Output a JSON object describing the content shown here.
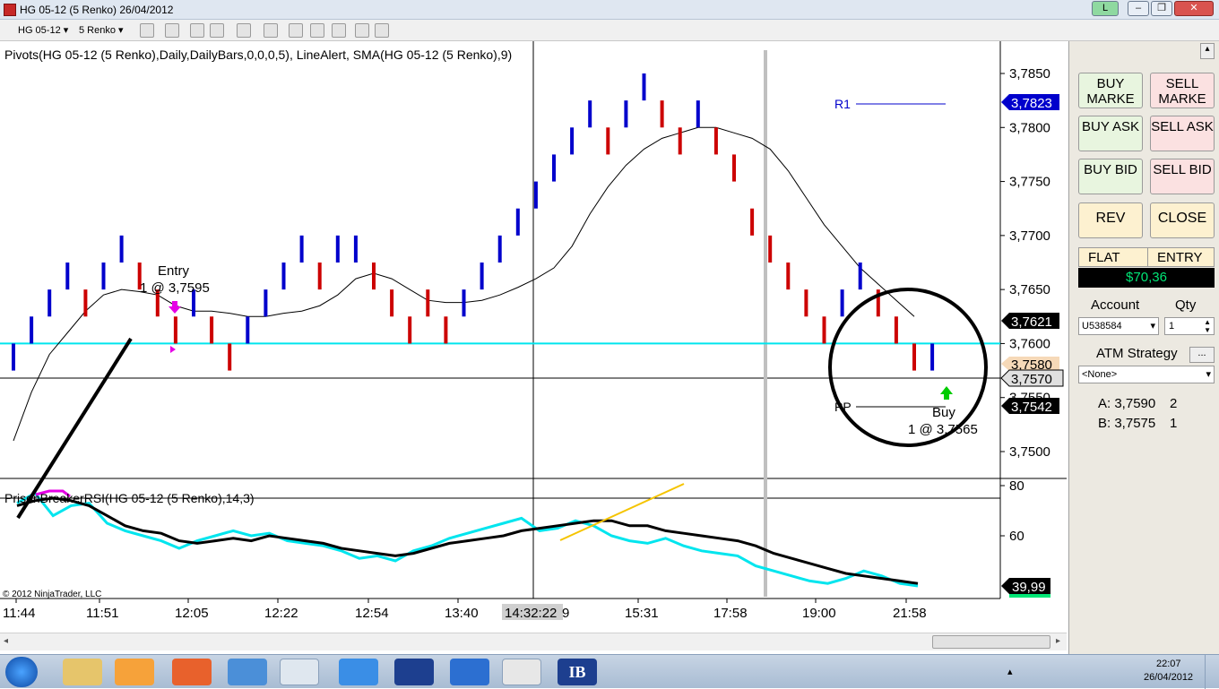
{
  "window": {
    "title": "HG 05-12 (5 Renko)  26/04/2012",
    "badge": "L"
  },
  "toolbar": {
    "instrument": "HG 05-12",
    "period": "5 Renko"
  },
  "chart": {
    "indicator_label": "Pivots(HG 05-12 (5 Renko),Daily,DailyBars,0,0,0,5), LineAlert, SMA(HG 05-12 (5 Renko),9)",
    "rsi_label": "PrisonBreakerRSI(HG 05-12 (5 Renko),14,3)",
    "copyright": "© 2012 NinjaTrader, LLC",
    "price_ticks": [
      "3,7850",
      "3,7800",
      "3,7750",
      "3,7700",
      "3,7650",
      "3,7600",
      "3,7550",
      "3,7500"
    ],
    "rsi_ticks": [
      "80",
      "60"
    ],
    "time_ticks": [
      "11:44",
      "11:51",
      "12:05",
      "12:22",
      "12:54",
      "13:40",
      "15:31",
      "17:58",
      "19:00",
      "21:58"
    ],
    "cursor_time": "14:32:22",
    "cursor_time_suffix": "9",
    "price_flags": {
      "r1": "3,7823",
      "sma": "3,7621",
      "ask": "3,7580",
      "cursor": "3,7570",
      "pp": "3,7542",
      "rsi": "39,99"
    },
    "pivot_r1": "R1",
    "pivot_pp": "PP",
    "entry_label": "Entry",
    "entry_detail": "1 @ 3,7595",
    "buy_label": "Buy",
    "buy_detail": "1 @ 3,7565",
    "colors": {
      "up": "#0000cc",
      "down": "#cc0000",
      "hline": "#00e5ee",
      "rsi_main": "#000000",
      "rsi_signal": "#00e5ee",
      "trend": "#f5c400"
    }
  },
  "chart_data": {
    "type": "renko",
    "brick_size": 0.0005,
    "bricks": [
      {
        "d": "up",
        "low": 3.7575,
        "high": 3.76
      },
      {
        "d": "up",
        "low": 3.76,
        "high": 3.7625
      },
      {
        "d": "up",
        "low": 3.7625,
        "high": 3.765
      },
      {
        "d": "up",
        "low": 3.765,
        "high": 3.7675
      },
      {
        "d": "down",
        "low": 3.7625,
        "high": 3.765
      },
      {
        "d": "up",
        "low": 3.765,
        "high": 3.7675
      },
      {
        "d": "up",
        "low": 3.7675,
        "high": 3.77
      },
      {
        "d": "down",
        "low": 3.765,
        "high": 3.7675
      },
      {
        "d": "down",
        "low": 3.7625,
        "high": 3.765
      },
      {
        "d": "down",
        "low": 3.76,
        "high": 3.7625
      },
      {
        "d": "up",
        "low": 3.7625,
        "high": 3.765
      },
      {
        "d": "down",
        "low": 3.76,
        "high": 3.7625
      },
      {
        "d": "down",
        "low": 3.7575,
        "high": 3.76
      },
      {
        "d": "up",
        "low": 3.76,
        "high": 3.7625
      },
      {
        "d": "up",
        "low": 3.7625,
        "high": 3.765
      },
      {
        "d": "up",
        "low": 3.765,
        "high": 3.7675
      },
      {
        "d": "up",
        "low": 3.7675,
        "high": 3.77
      },
      {
        "d": "down",
        "low": 3.765,
        "high": 3.7675
      },
      {
        "d": "up",
        "low": 3.7675,
        "high": 3.77
      },
      {
        "d": "up",
        "low": 3.7675,
        "high": 3.77
      },
      {
        "d": "down",
        "low": 3.765,
        "high": 3.7675
      },
      {
        "d": "down",
        "low": 3.7625,
        "high": 3.765
      },
      {
        "d": "down",
        "low": 3.76,
        "high": 3.7625
      },
      {
        "d": "down",
        "low": 3.7625,
        "high": 3.765
      },
      {
        "d": "down",
        "low": 3.76,
        "high": 3.7625
      },
      {
        "d": "up",
        "low": 3.7625,
        "high": 3.765
      },
      {
        "d": "up",
        "low": 3.765,
        "high": 3.7675
      },
      {
        "d": "up",
        "low": 3.7675,
        "high": 3.77
      },
      {
        "d": "up",
        "low": 3.77,
        "high": 3.7725
      },
      {
        "d": "up",
        "low": 3.7725,
        "high": 3.775
      },
      {
        "d": "up",
        "low": 3.775,
        "high": 3.7775
      },
      {
        "d": "up",
        "low": 3.7775,
        "high": 3.78
      },
      {
        "d": "up",
        "low": 3.78,
        "high": 3.7825
      },
      {
        "d": "down",
        "low": 3.7775,
        "high": 3.78
      },
      {
        "d": "up",
        "low": 3.78,
        "high": 3.7825
      },
      {
        "d": "up",
        "low": 3.7825,
        "high": 3.785
      },
      {
        "d": "down",
        "low": 3.78,
        "high": 3.7825
      },
      {
        "d": "down",
        "low": 3.7775,
        "high": 3.78
      },
      {
        "d": "up",
        "low": 3.78,
        "high": 3.7825
      },
      {
        "d": "down",
        "low": 3.7775,
        "high": 3.78
      },
      {
        "d": "down",
        "low": 3.775,
        "high": 3.7775
      },
      {
        "d": "down",
        "low": 3.77,
        "high": 3.7725
      },
      {
        "d": "down",
        "low": 3.7675,
        "high": 3.77
      },
      {
        "d": "down",
        "low": 3.765,
        "high": 3.7675
      },
      {
        "d": "down",
        "low": 3.7625,
        "high": 3.765
      },
      {
        "d": "down",
        "low": 3.76,
        "high": 3.7625
      },
      {
        "d": "up",
        "low": 3.7625,
        "high": 3.765
      },
      {
        "d": "up",
        "low": 3.765,
        "high": 3.7675
      },
      {
        "d": "down",
        "low": 3.7625,
        "high": 3.765
      },
      {
        "d": "down",
        "low": 3.76,
        "high": 3.7625
      },
      {
        "d": "down",
        "low": 3.7575,
        "high": 3.76
      },
      {
        "d": "up",
        "low": 3.7575,
        "high": 3.76
      }
    ],
    "sma": [
      3.751,
      3.7555,
      3.759,
      3.761,
      3.763,
      3.7645,
      3.765,
      3.7648,
      3.7645,
      3.7635,
      3.763,
      3.763,
      3.7628,
      3.7625,
      3.7625,
      3.7628,
      3.763,
      3.7635,
      3.7645,
      3.766,
      3.7665,
      3.766,
      3.765,
      3.764,
      3.7638,
      3.7638,
      3.764,
      3.7645,
      3.7652,
      3.766,
      3.767,
      3.769,
      3.772,
      3.7745,
      3.7765,
      3.778,
      3.779,
      3.7795,
      3.78,
      3.78,
      3.7795,
      3.779,
      3.778,
      3.776,
      3.7735,
      3.771,
      3.769,
      3.767,
      3.7655,
      3.764,
      3.7625
    ],
    "rsi_main": [
      72,
      74,
      75,
      74,
      72,
      68,
      64,
      62,
      61,
      58,
      57,
      58,
      59,
      58,
      60,
      59,
      58,
      57,
      55,
      54,
      53,
      52,
      53,
      55,
      57,
      58,
      59,
      60,
      62,
      63,
      64,
      65,
      66,
      66,
      64,
      64,
      62,
      61,
      60,
      59,
      58,
      56,
      53,
      51,
      49,
      47,
      45,
      44,
      43,
      42,
      41
    ],
    "rsi_signal": [
      73,
      77,
      68,
      72,
      73,
      65,
      62,
      60,
      58,
      55,
      58,
      60,
      62,
      60,
      61,
      58,
      57,
      56,
      54,
      51,
      52,
      50,
      54,
      56,
      59,
      61,
      63,
      65,
      67,
      62,
      63,
      66,
      64,
      60,
      58,
      57,
      59,
      56,
      54,
      53,
      52,
      48,
      46,
      44,
      42,
      41,
      43,
      46,
      44,
      41,
      40
    ],
    "ylim_price": [
      3.7475,
      3.7875
    ],
    "ylim_rsi": [
      35,
      85
    ],
    "pivots": {
      "R1": 3.7823,
      "PP": 3.7542
    },
    "hline": 3.76
  },
  "panel": {
    "buy_market": "BUY MARKE",
    "sell_market": "SELL MARKE",
    "buy_ask": "BUY ASK",
    "sell_ask": "SELL ASK",
    "buy_bid": "BUY BID",
    "sell_bid": "SELL BID",
    "rev": "REV",
    "close": "CLOSE",
    "flat": "FLAT",
    "entry": "ENTRY",
    "pnl": "$70,36",
    "account_label": "Account",
    "qty_label": "Qty",
    "account_value": "U538584",
    "qty_value": "1",
    "atm_label": "ATM Strategy",
    "atm_btn": "...",
    "atm_value": "<None>",
    "ask_label": "A: 3,7590",
    "ask_size": "2",
    "bid_label": "B: 3,7575",
    "bid_size": "1"
  },
  "taskbar": {
    "time": "22:07",
    "date": "26/04/2012",
    "ib_label": "IB"
  }
}
